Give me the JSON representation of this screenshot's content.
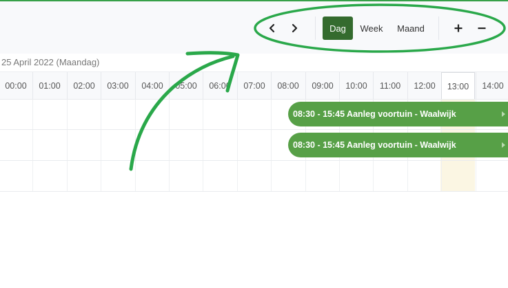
{
  "toolbar": {
    "prev_icon": "chevron-left-icon",
    "next_icon": "chevron-right-icon",
    "views": [
      {
        "label": "Dag",
        "active": true
      },
      {
        "label": "Week",
        "active": false
      },
      {
        "label": "Maand",
        "active": false
      }
    ],
    "zoom_in": "+",
    "zoom_out": "−",
    "active_color": "#346b2e"
  },
  "date_label": "25 April 2022 (Maandag)",
  "hours": [
    "00:00",
    "01:00",
    "02:00",
    "03:00",
    "04:00",
    "05:00",
    "06:00",
    "07:00",
    "08:00",
    "09:00",
    "10:00",
    "11:00",
    "12:00",
    "13:00",
    "14:00"
  ],
  "current_hour": "13:00",
  "events": [
    {
      "label": "08:30 - 15:45 Aanleg voortuin - Waalwijk"
    },
    {
      "label": "08:30 - 15:45 Aanleg voortuin - Waalwijk"
    }
  ],
  "colors": {
    "event": "#57a047",
    "annotation": "#2aa84a",
    "today_column": "#fbf6e3"
  },
  "annotation": {
    "arrow_icon": "hand-drawn-arrow",
    "highlight": "hand-drawn-ellipse"
  }
}
